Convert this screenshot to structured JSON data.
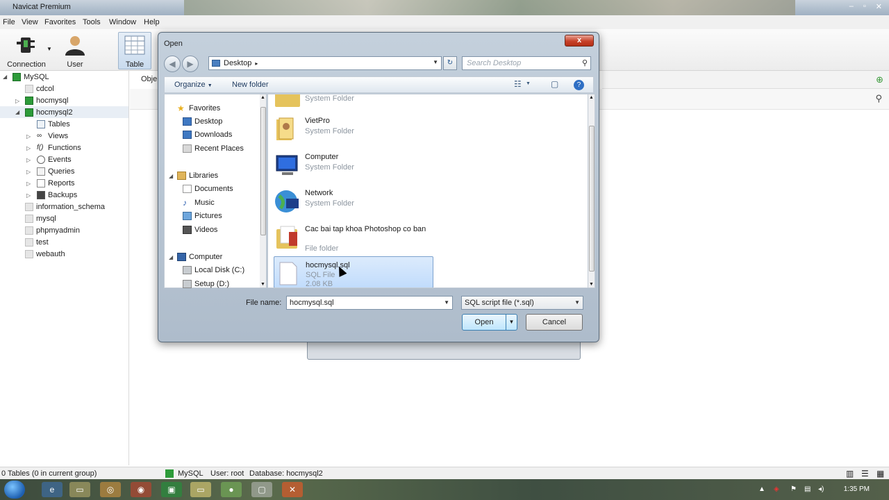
{
  "window": {
    "title": "Navicat Premium"
  },
  "menu": [
    "File",
    "View",
    "Favorites",
    "Tools",
    "Window",
    "Help"
  ],
  "toolbar": {
    "connection_label": "Connection",
    "user_label": "User",
    "table_label": "Table"
  },
  "sidebar": {
    "items": [
      {
        "label": "MySQL",
        "level": 0,
        "icon": "mysql-connection-icon"
      },
      {
        "label": "cdcol",
        "level": 1,
        "icon": "database-icon"
      },
      {
        "label": "hocmysql",
        "level": 1,
        "icon": "database-icon"
      },
      {
        "label": "hocmysql2",
        "level": 1,
        "icon": "database-icon"
      },
      {
        "label": "Tables",
        "level": 2,
        "icon": "tables-icon"
      },
      {
        "label": "Views",
        "level": 2,
        "icon": "views-icon"
      },
      {
        "label": "Functions",
        "level": 2,
        "icon": "functions-icon"
      },
      {
        "label": "Events",
        "level": 2,
        "icon": "events-icon"
      },
      {
        "label": "Queries",
        "level": 2,
        "icon": "queries-icon"
      },
      {
        "label": "Reports",
        "level": 2,
        "icon": "reports-icon"
      },
      {
        "label": "Backups",
        "level": 2,
        "icon": "backups-icon"
      },
      {
        "label": "information_schema",
        "level": 1,
        "icon": "database-icon"
      },
      {
        "label": "mysql",
        "level": 1,
        "icon": "database-icon"
      },
      {
        "label": "phpmyadmin",
        "level": 1,
        "icon": "database-icon"
      },
      {
        "label": "test",
        "level": 1,
        "icon": "database-icon"
      },
      {
        "label": "webauth",
        "level": 1,
        "icon": "database-icon"
      }
    ]
  },
  "rightpanel": {
    "objects_label": "Obje"
  },
  "statusbar": {
    "tables_count": "0 Tables (0 in current group)",
    "connection": "MySQL",
    "user": "User: root",
    "database": "Database: hocmysql2"
  },
  "dialog": {
    "title": "Open",
    "close_label": "x",
    "address": "Desktop",
    "search_placeholder": "Search Desktop",
    "organize_label": "Organize",
    "new_folder_label": "New folder",
    "nav": {
      "favorites_header": "Favorites",
      "favorites": [
        "Desktop",
        "Downloads",
        "Recent Places"
      ],
      "libraries_header": "Libraries",
      "libraries": [
        "Documents",
        "Music",
        "Pictures",
        "Videos"
      ],
      "computer_header": "Computer",
      "computer": [
        "Local Disk (C:)",
        "Setup (D:)"
      ]
    },
    "files": [
      {
        "name": "",
        "type": "System Folder",
        "size": "",
        "icon": "folder-icon"
      },
      {
        "name": "VietPro",
        "type": "System Folder",
        "size": "",
        "icon": "user-folder-icon"
      },
      {
        "name": "Computer",
        "type": "System Folder",
        "size": "",
        "icon": "computer-icon"
      },
      {
        "name": "Network",
        "type": "System Folder",
        "size": "",
        "icon": "network-icon"
      },
      {
        "name": "Cac bai tap khoa Photoshop co ban",
        "type": "File folder",
        "size": "",
        "icon": "folder-icon"
      },
      {
        "name": "hocmysql.sql",
        "type": "SQL File",
        "size": "2.08 KB",
        "icon": "sql-file-icon"
      }
    ],
    "filename_label": "File name:",
    "filename_value": "hocmysql.sql",
    "filetype_value": "SQL script file (*.sql)",
    "open_label": "Open",
    "cancel_label": "Cancel"
  },
  "taskbar": {
    "clock": "1:35 PM"
  },
  "colors": {
    "accent_blue": "#3c7fb1",
    "mysql_green": "#2d9b39",
    "selection": "#c1dcfc"
  }
}
